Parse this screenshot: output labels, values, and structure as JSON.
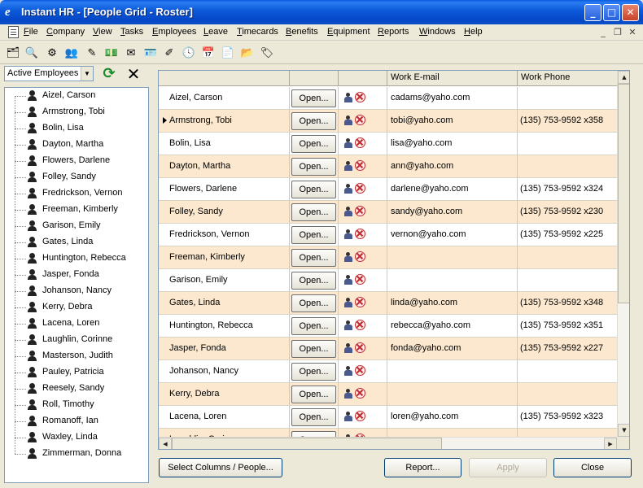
{
  "window": {
    "title": "Instant HR - [People Grid - Roster]",
    "app_icon": "instant-hr-logo",
    "minimize": "_",
    "maximize": "□",
    "close": "✕"
  },
  "menu": {
    "items": [
      "File",
      "Company",
      "View",
      "Tasks",
      "Employees",
      "Leave",
      "Timecards",
      "Benefits",
      "Equipment",
      "Reports",
      "Windows",
      "Help"
    ],
    "mdi_minimize": "_",
    "mdi_restore": "❐",
    "mdi_close": "✕"
  },
  "toolbar": {
    "buttons": [
      "org-chart-icon",
      "find-people-icon",
      "hierarchy-icon",
      "people-group-icon",
      "edit-card-icon",
      "pay-money-icon",
      "leave-card-icon",
      "id-card-icon",
      "edit-note-icon",
      "clock-icon",
      "timesheet-icon",
      "add-document-icon",
      "open-folder-icon",
      "tag-icon"
    ]
  },
  "left": {
    "filter_value": "Active Employees",
    "refresh": "⟳",
    "clear": "✕",
    "employees": [
      "Aizel, Carson",
      "Armstrong, Tobi",
      "Bolin, Lisa",
      "Dayton, Martha",
      "Flowers, Darlene",
      "Folley, Sandy",
      "Fredrickson, Vernon",
      "Freeman, Kimberly",
      "Garison, Emily",
      "Gates, Linda",
      "Huntington, Rebecca",
      "Jasper, Fonda",
      "Johanson, Nancy",
      "Kerry, Debra",
      "Lacena, Loren",
      "Laughlin, Corinne",
      "Masterson, Judith",
      "Pauley, Patricia",
      "Reesely, Sandy",
      "Roll, Timothy",
      "Romanoff, Ian",
      "Waxley, Linda",
      "Zimmerman, Donna"
    ]
  },
  "grid": {
    "columns": {
      "name": "",
      "open": "",
      "actions": "",
      "email": "Work E-mail",
      "phone": "Work Phone"
    },
    "open_label": "Open...",
    "current_row": 1,
    "rows": [
      {
        "name": "Aizel, Carson",
        "email": "cadams@yaho.com",
        "phone": ""
      },
      {
        "name": "Armstrong, Tobi",
        "email": "tobi@yaho.com",
        "phone": "(135) 753-9592 x358"
      },
      {
        "name": "Bolin, Lisa",
        "email": "lisa@yaho.com",
        "phone": ""
      },
      {
        "name": "Dayton, Martha",
        "email": "ann@yaho.com",
        "phone": ""
      },
      {
        "name": "Flowers, Darlene",
        "email": "darlene@yaho.com",
        "phone": "(135) 753-9592 x324"
      },
      {
        "name": "Folley, Sandy",
        "email": "sandy@yaho.com",
        "phone": "(135) 753-9592 x230"
      },
      {
        "name": "Fredrickson, Vernon",
        "email": "vernon@yaho.com",
        "phone": "(135) 753-9592 x225"
      },
      {
        "name": "Freeman, Kimberly",
        "email": "",
        "phone": ""
      },
      {
        "name": "Garison, Emily",
        "email": "",
        "phone": ""
      },
      {
        "name": "Gates, Linda",
        "email": "linda@yaho.com",
        "phone": "(135) 753-9592 x348"
      },
      {
        "name": "Huntington, Rebecca",
        "email": "rebecca@yaho.com",
        "phone": "(135) 753-9592 x351"
      },
      {
        "name": "Jasper, Fonda",
        "email": "fonda@yaho.com",
        "phone": "(135) 753-9592 x227"
      },
      {
        "name": "Johanson, Nancy",
        "email": "",
        "phone": ""
      },
      {
        "name": "Kerry, Debra",
        "email": "",
        "phone": ""
      },
      {
        "name": "Lacena, Loren",
        "email": "loren@yaho.com",
        "phone": "(135) 753-9592 x323"
      },
      {
        "name": "Laughlin, Corinne",
        "email": "",
        "phone": ""
      }
    ],
    "alt_row_color": "#fbe8cf"
  },
  "buttons": {
    "select_columns": "Select Columns / People...",
    "report": "Report...",
    "apply": "Apply",
    "close": "Close"
  },
  "colors": {
    "titlebar": "#0a4fc8",
    "window_face": "#ece9d8",
    "delete_red": "#c0282c"
  }
}
